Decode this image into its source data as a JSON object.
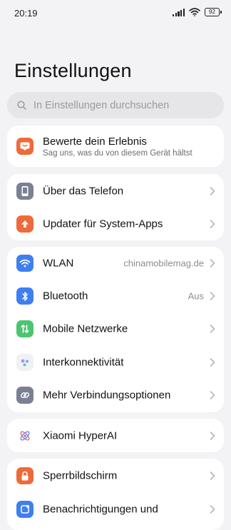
{
  "status_bar": {
    "time": "20:19",
    "battery": "92"
  },
  "page": {
    "title": "Einstellungen"
  },
  "search": {
    "placeholder": "In Einstellungen durchsuchen"
  },
  "rating_card": {
    "title": "Bewerte dein Erlebnis",
    "subtitle": "Sag uns, was du von diesem Gerät hältst",
    "icon": "feedback-icon"
  },
  "group1": [
    {
      "label": "Über das Telefon",
      "icon": "phone-icon",
      "color": "#7b8194"
    },
    {
      "label": "Updater für System-Apps",
      "icon": "upload-arrow-icon",
      "color": "#ef6a3a"
    }
  ],
  "group2": [
    {
      "label": "WLAN",
      "value": "chinamobilemag.de",
      "icon": "wifi-icon",
      "color": "#3f7ff0"
    },
    {
      "label": "Bluetooth",
      "value": "Aus",
      "icon": "bluetooth-icon",
      "color": "#3f7ff0"
    },
    {
      "label": "Mobile Netzwerke",
      "icon": "mobile-data-icon",
      "color": "#4cc470"
    },
    {
      "label": "Interkonnektivität",
      "icon": "interconnect-icon",
      "color": "#f1f1f4"
    },
    {
      "label": "Mehr Verbindungsoptionen",
      "icon": "link-icon",
      "color": "#7b8194"
    }
  ],
  "group3": [
    {
      "label": "Xiaomi HyperAI",
      "icon": "hyperai-icon"
    }
  ],
  "group4": [
    {
      "label": "Sperrbildschirm",
      "icon": "lock-icon",
      "color": "#ef6a3a"
    },
    {
      "label": "Benachrichtigungen und",
      "icon": "notification-icon",
      "color": "#3f7ff0"
    }
  ]
}
